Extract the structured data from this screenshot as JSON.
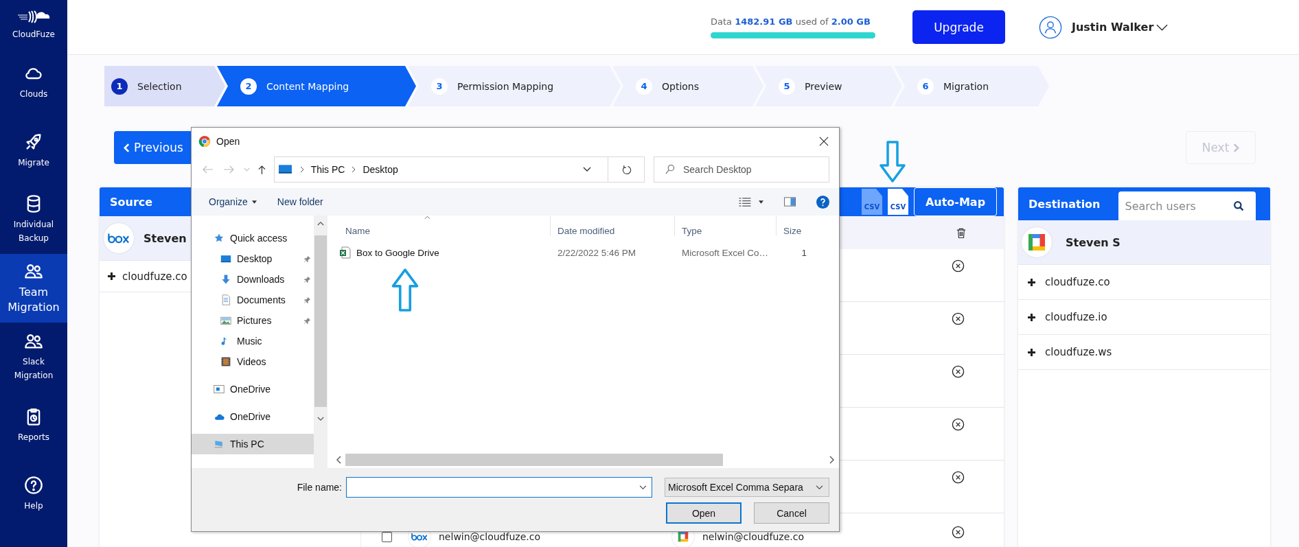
{
  "sidebar": {
    "brand": "CloudFuze",
    "items": [
      {
        "label": "Clouds",
        "selected": false
      },
      {
        "label": "Migrate",
        "selected": false
      },
      {
        "label": "Individual Backup",
        "selected": false
      },
      {
        "label": "Team Migration",
        "selected": true
      },
      {
        "label": "Slack Migration",
        "selected": false
      },
      {
        "label": "Reports",
        "selected": false
      },
      {
        "label": "Help",
        "selected": false
      }
    ]
  },
  "header": {
    "usage": {
      "label": "Data",
      "used": "1482.91 GB",
      "middle": "used of",
      "total": "2.00 GB",
      "level": 1
    },
    "upgrade": "Upgrade",
    "user": "Justin Walker"
  },
  "steps": [
    {
      "number": "1",
      "label": "Selection",
      "selected": false,
      "completed": true
    },
    {
      "number": "2",
      "label": "Content Mapping",
      "selected": true,
      "completed": false
    },
    {
      "number": "3",
      "label": "Permission Mapping",
      "selected": false,
      "completed": false
    },
    {
      "number": "4",
      "label": "Options",
      "selected": false,
      "completed": false
    },
    {
      "number": "5",
      "label": "Preview",
      "selected": false,
      "completed": false
    },
    {
      "number": "6",
      "label": "Migration",
      "selected": false,
      "completed": false
    }
  ],
  "nav": {
    "previous": "Previous",
    "next": "Next",
    "next_disabled": true
  },
  "source": {
    "title": "Source",
    "user": "Steven",
    "domains": [
      "cloudfuze.co"
    ]
  },
  "mapping": {
    "csv_download": "CSV",
    "csv_upload": "CSV",
    "auto_map": "Auto-Map",
    "rows": [
      {
        "removable": true
      },
      {
        "removable": true
      },
      {
        "removable": true
      },
      {
        "removable": true
      },
      {
        "removable": true
      },
      {
        "removable": true,
        "checked": false,
        "source_email": "nelwin@cloudfuze.co",
        "destination_email": "nelwin@cloudfuze.co"
      }
    ]
  },
  "destination": {
    "title": "Destination",
    "search_placeholder": "Search users",
    "user": "Steven S",
    "domains": [
      "cloudfuze.co",
      "cloudfuze.io",
      "cloudfuze.ws"
    ]
  },
  "dialog": {
    "title": "Open",
    "breadcrumb": [
      "This PC",
      "Desktop"
    ],
    "search_placeholder": "Search Desktop",
    "organize": "Organize",
    "new_folder": "New folder",
    "nav": [
      {
        "label": "Quick access",
        "selected": false,
        "children": [
          {
            "label": "Desktop",
            "pinned": true,
            "selected": false
          },
          {
            "label": "Downloads",
            "pinned": true,
            "selected": false
          },
          {
            "label": "Documents",
            "pinned": true,
            "selected": false
          },
          {
            "label": "Pictures",
            "pinned": true,
            "selected": false
          },
          {
            "label": "Music",
            "pinned": false,
            "selected": false
          },
          {
            "label": "Videos",
            "pinned": false,
            "selected": false
          }
        ]
      },
      {
        "label": "OneDrive",
        "selected": false
      },
      {
        "label": "OneDrive",
        "selected": false
      },
      {
        "label": "This PC",
        "selected": true
      }
    ],
    "columns": [
      "Name",
      "Date modified",
      "Type",
      "Size"
    ],
    "files": [
      {
        "name": "Box to Google Drive",
        "date": "2/22/2022 5:46 PM",
        "type": "Microsoft Excel Co…",
        "size": "1"
      }
    ],
    "file_name_label": "File name:",
    "file_type": "Microsoft Excel Comma Separa",
    "buttons": [
      "Open",
      "Cancel"
    ]
  }
}
